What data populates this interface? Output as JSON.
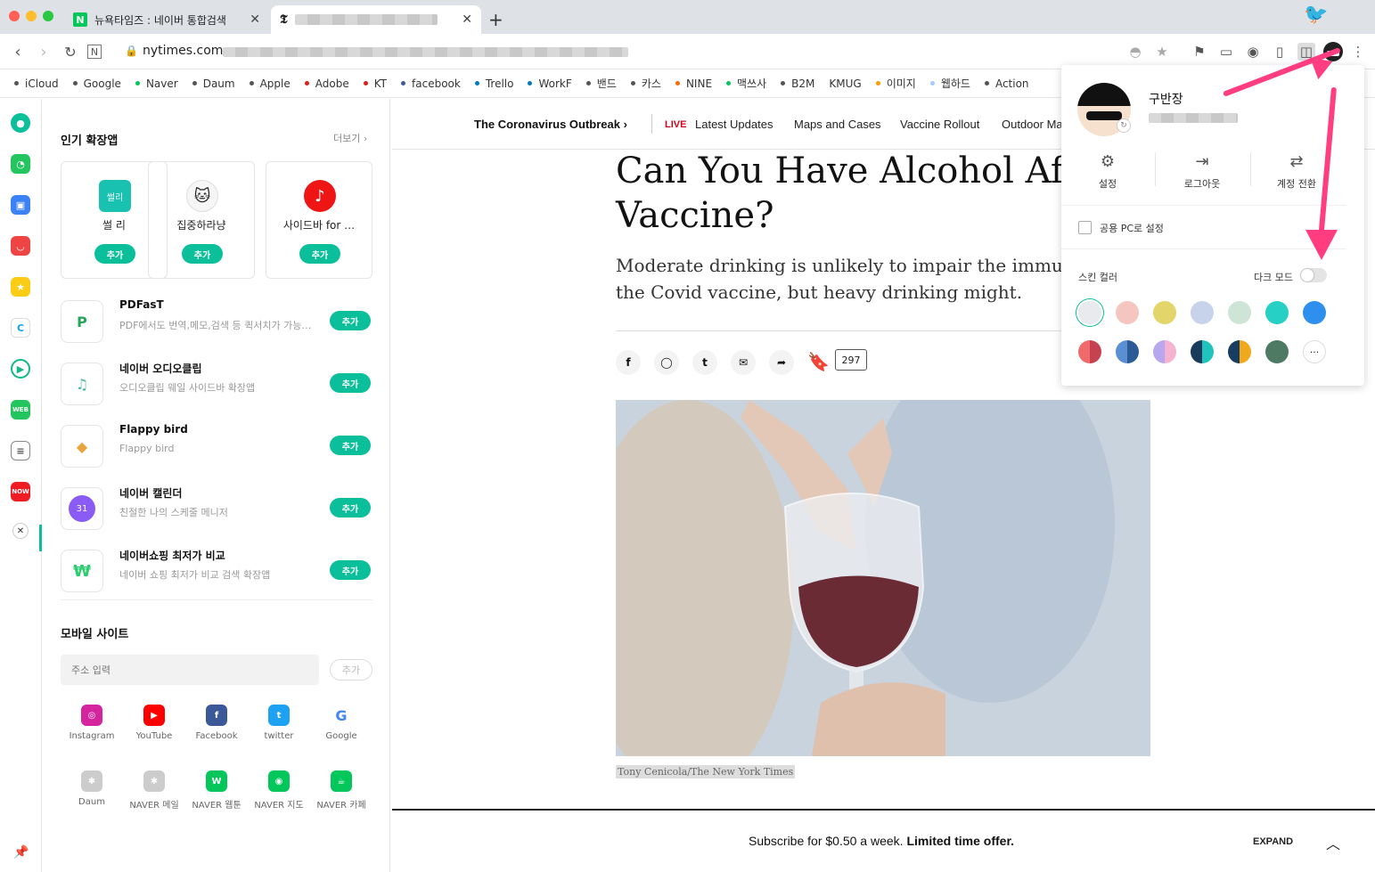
{
  "tabs": [
    {
      "title": "뉴욕타임즈 : 네이버 통합검색",
      "active": false
    },
    {
      "title": "",
      "active": true
    }
  ],
  "address": {
    "url": "nytimes.com"
  },
  "bookmarks": [
    {
      "label": "iCloud",
      "color": "#555555"
    },
    {
      "label": "Google",
      "color": "#555555"
    },
    {
      "label": "Naver",
      "color": "#03c75a"
    },
    {
      "label": "Daum",
      "color": "#555555"
    },
    {
      "label": "Apple",
      "color": "#555555"
    },
    {
      "label": "Adobe",
      "color": "#e01e1e"
    },
    {
      "label": "KT",
      "color": "#e01e1e"
    },
    {
      "label": "facebook",
      "color": "#3b5998"
    },
    {
      "label": "Trello",
      "color": "#0079bf"
    },
    {
      "label": "WorkF",
      "color": "#0079bf"
    },
    {
      "label": "밴드",
      "color": "#555555"
    },
    {
      "label": "카스",
      "color": "#555555"
    },
    {
      "label": "NINE",
      "color": "#ff6a00"
    },
    {
      "label": "맥쓰사",
      "color": "#03c75a"
    },
    {
      "label": "B2M",
      "color": "#555555"
    },
    {
      "label": "KMUG",
      "color": ""
    },
    {
      "label": "이미지",
      "color": "#ff9900"
    },
    {
      "label": "웹하드",
      "color": "#a8c8ff"
    },
    {
      "label": "Action",
      "color": "#555555"
    }
  ],
  "panel": {
    "popular_title": "인기 확장앱",
    "more": "더보기",
    "add_label": "추가",
    "cards": [
      {
        "name": "썰 리",
        "icon_text": "썰리",
        "color": "#19c2b0"
      },
      {
        "name": "집중하라냥",
        "icon_text": "",
        "color": "#f2f2f2"
      },
      {
        "name": "사이드바 for …",
        "icon_text": "♪",
        "color": "#f01515"
      }
    ],
    "apps": [
      {
        "name": "PDFasT",
        "desc": "PDF에서도 번역,메모,검색 등 퀵서치가 가능…",
        "color": "#26a65b",
        "glyph": "P"
      },
      {
        "name": "네이버 오디오클립",
        "desc": "오디오클립 웨일 사이드바 확장앱",
        "color": "#4ab8a3",
        "glyph": "♫"
      },
      {
        "name": "Flappy bird",
        "desc": "Flappy bird",
        "color": "#e8a33a",
        "glyph": "◆"
      },
      {
        "name": "네이버 캘린더",
        "desc": "친절한 나의 스케줄 메니저",
        "color": "#8a5cf5",
        "glyph": "31"
      },
      {
        "name": "네이버쇼핑 최저가 비교",
        "desc": "네이버 쇼핑 최저가 비교 검색 확장앱",
        "color": "#2ecc71",
        "glyph": "₩"
      }
    ],
    "mobile_title": "모바일 사이트",
    "address_placeholder": "주소 입력",
    "address_add": "추가",
    "sites_row1": [
      {
        "label": "Instagram",
        "color": "#d6249f",
        "glyph": "◎"
      },
      {
        "label": "YouTube",
        "color": "#ff0000",
        "glyph": "▶"
      },
      {
        "label": "Facebook",
        "color": "#3b5998",
        "glyph": "f"
      },
      {
        "label": "twitter",
        "color": "#1da1f2",
        "glyph": "t"
      },
      {
        "label": "Google",
        "color": "#ffffff",
        "glyph": "G"
      }
    ],
    "sites_row2": [
      {
        "label": "Daum",
        "color": "#cccccc",
        "glyph": "✱"
      },
      {
        "label": "NAVER 메일",
        "color": "#cccccc",
        "glyph": "✱"
      },
      {
        "label": "NAVER 웹툰",
        "color": "#03c75a",
        "glyph": "W"
      },
      {
        "label": "NAVER 지도",
        "color": "#03c75a",
        "glyph": "◉"
      },
      {
        "label": "NAVER 카페",
        "color": "#03c75a",
        "glyph": "☕"
      }
    ]
  },
  "article": {
    "nav": {
      "outbreak": "The Coronavirus Outbreak ›",
      "live": "LIVE",
      "latest": "Latest Updates",
      "maps": "Maps and Cases",
      "vaccine": "Vaccine Rollout",
      "outdoor": "Outdoor Ma"
    },
    "headline": "Can You Have Alcohol After t Vaccine?",
    "dek": "Moderate drinking is unlikely to impair the immune re the Covid vaccine, but heavy drinking might.",
    "comment_count": "297",
    "caption": "Tony Cenicola/The New York Times",
    "subscribe_text": "Subscribe for $0.50 a week.",
    "subscribe_offer": "Limited time offer.",
    "expand": "EXPAND"
  },
  "popup": {
    "user_name": "구반장",
    "settings": "설정",
    "logout": "로그아웃",
    "switch_account": "계정 전환",
    "public_pc": "공용 PC로 설정",
    "skin_color": "스킨 컬러",
    "dark_mode": "다크 모드",
    "more": "···",
    "swatches_row1": [
      "#e8eaed",
      "#f5c6c0",
      "#e3d56a",
      "#c7d3ea",
      "#cde4d7",
      "#26d0c4",
      "#2f8fef"
    ],
    "swatches_row2": [
      [
        "#ef6b6b",
        "#c74250"
      ],
      [
        "#5b8fd4",
        "#2b5a95"
      ],
      [
        "#b8a6ef",
        "#f6b3d1"
      ],
      [
        "#1a3b5c",
        "#1fc4bc"
      ],
      [
        "#183d60",
        "#f0a81c"
      ],
      [
        "#4e7a63",
        "#4e7a63"
      ]
    ]
  }
}
